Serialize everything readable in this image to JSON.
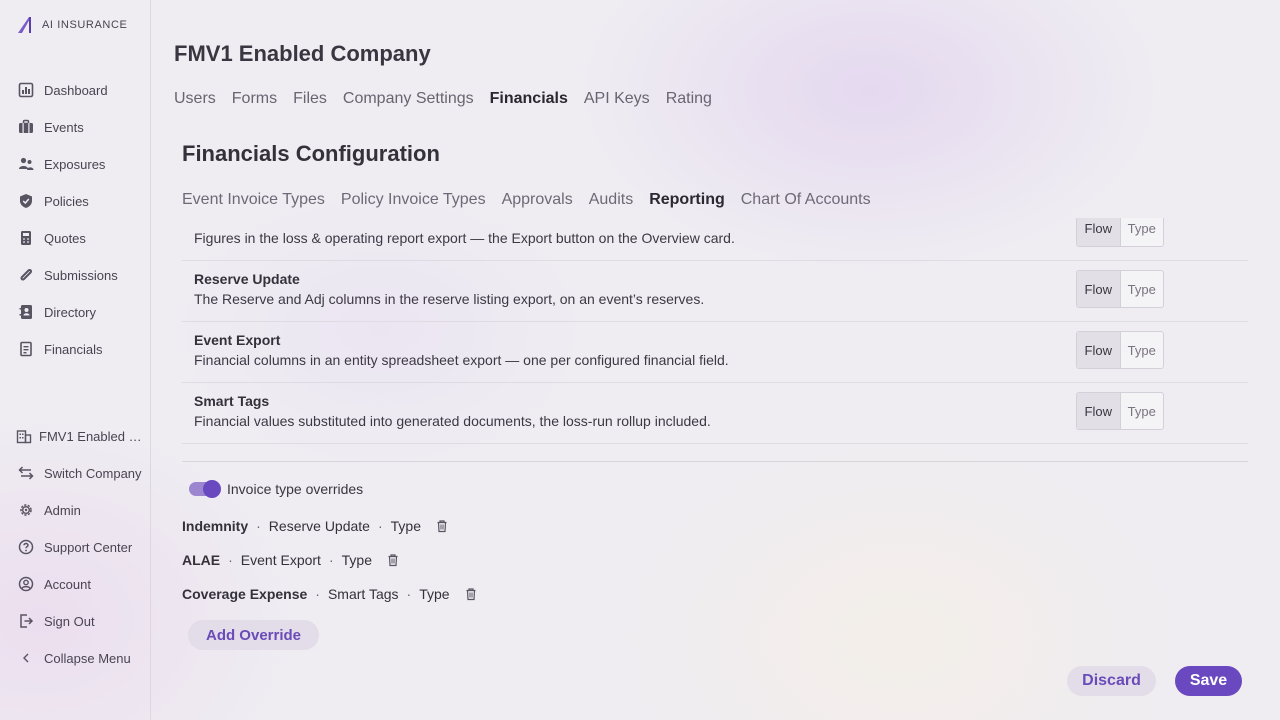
{
  "app": {
    "logo_text": "AI INSURANCE",
    "accent": "#6a48c0"
  },
  "sidebar": {
    "items": [
      {
        "label": "Dashboard",
        "icon": "chart-icon"
      },
      {
        "label": "Events",
        "icon": "briefcase-icon"
      },
      {
        "label": "Exposures",
        "icon": "users-icon"
      },
      {
        "label": "Policies",
        "icon": "shield-icon"
      },
      {
        "label": "Quotes",
        "icon": "calculator-icon"
      },
      {
        "label": "Submissions",
        "icon": "paperclip-icon"
      },
      {
        "label": "Directory",
        "icon": "contacts-icon"
      },
      {
        "label": "Financials",
        "icon": "receipt-icon"
      }
    ],
    "bottom": [
      {
        "label": "FMV1 Enabled Company",
        "icon": "building-icon"
      },
      {
        "label": "Switch Company",
        "icon": "swap-icon"
      },
      {
        "label": "Admin",
        "icon": "gear-icon"
      },
      {
        "label": "Support Center",
        "icon": "help-icon"
      },
      {
        "label": "Account",
        "icon": "user-circle-icon"
      },
      {
        "label": "Sign Out",
        "icon": "sign-out-icon"
      },
      {
        "label": "Collapse Menu",
        "icon": "chevron-left-icon"
      }
    ]
  },
  "header": {
    "title": "FMV1 Enabled Company",
    "tabs": [
      "Users",
      "Forms",
      "Files",
      "Company Settings",
      "Financials",
      "API Keys",
      "Rating"
    ],
    "active_tab": "Financials"
  },
  "section": {
    "title": "Financials Configuration",
    "tabs": [
      "Event Invoice Types",
      "Policy Invoice Types",
      "Approvals",
      "Audits",
      "Reporting",
      "Chart Of Accounts"
    ],
    "active_tab": "Reporting"
  },
  "rows": [
    {
      "title": "",
      "desc": "Figures in the loss & operating report export — the Export button on the Overview card.",
      "flow": "Flow",
      "type": "Type",
      "selected": "Flow"
    },
    {
      "title": "Reserve Update",
      "desc": "The Reserve and Adj columns in the reserve listing export, on an event’s reserves.",
      "flow": "Flow",
      "type": "Type",
      "selected": "Flow"
    },
    {
      "title": "Event Export",
      "desc": "Financial columns in an entity spreadsheet export — one per configured financial field.",
      "flow": "Flow",
      "type": "Type",
      "selected": "Flow"
    },
    {
      "title": "Smart Tags",
      "desc": "Financial values substituted into generated documents, the loss-run rollup included.",
      "flow": "Flow",
      "type": "Type",
      "selected": "Flow"
    }
  ],
  "overrides": {
    "toggle_label": "Invoice type overrides",
    "toggle_on": true,
    "items": [
      {
        "name": "Indemnity",
        "target": "Reserve Update",
        "mode": "Type"
      },
      {
        "name": "ALAE",
        "target": "Event Export",
        "mode": "Type"
      },
      {
        "name": "Coverage Expense",
        "target": "Smart Tags",
        "mode": "Type"
      }
    ],
    "separator": "·",
    "add_label": "Add Override"
  },
  "footer": {
    "discard_label": "Discard",
    "save_label": "Save"
  }
}
